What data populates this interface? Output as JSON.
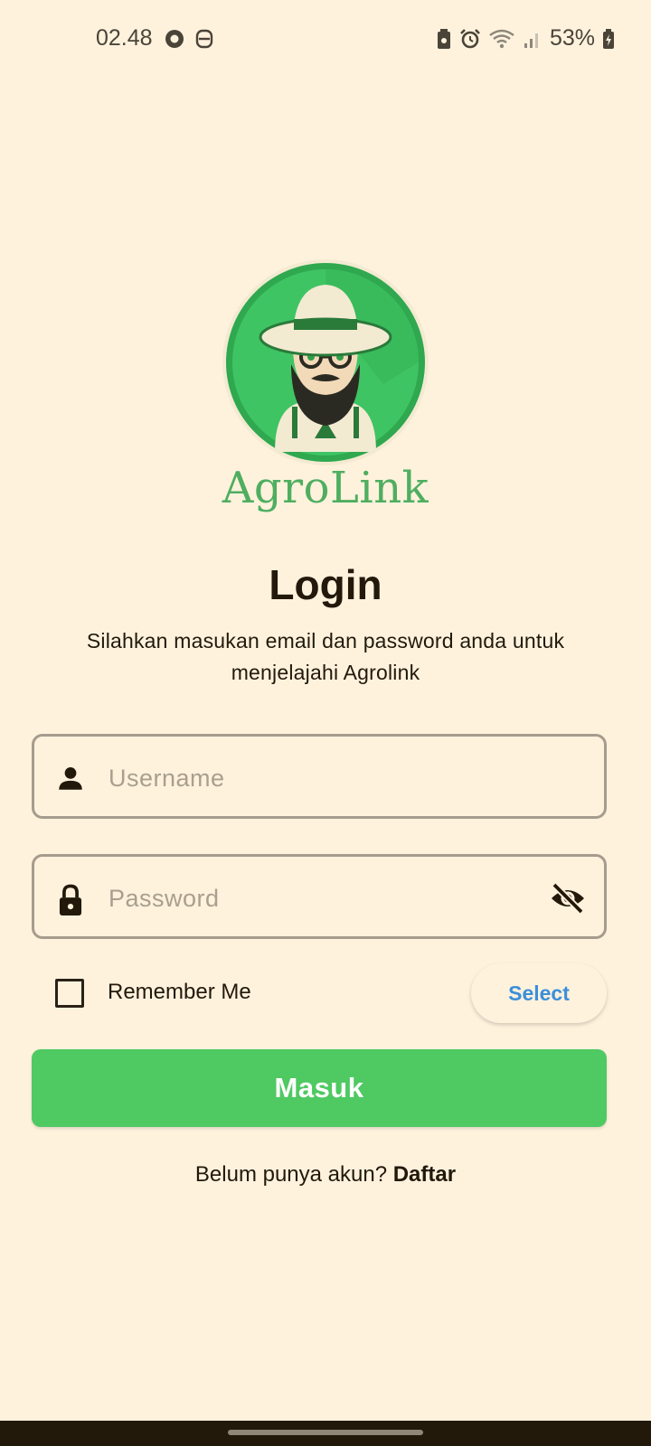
{
  "status_bar": {
    "time": "02.48",
    "battery_percent": "53%",
    "left_icons": [
      "circle-app-icon",
      "notification-app-icon"
    ],
    "right_icons": [
      "battery-saver-icon",
      "alarm-icon",
      "wifi-icon",
      "signal-icon",
      "battery-charging-icon"
    ]
  },
  "brand": {
    "name": "AgroLink",
    "logo_icon": "farmer-logo-icon"
  },
  "login": {
    "title": "Login",
    "subtitle": "Silahkan masukan email dan password anda untuk menjelajahi Agrolink",
    "username": {
      "placeholder": "Username",
      "value": "",
      "icon": "person-icon"
    },
    "password": {
      "placeholder": "Password",
      "value": "",
      "icon": "lock-icon",
      "toggle_icon": "visibility-off-icon"
    },
    "remember_me": {
      "label": "Remember Me",
      "checked": false
    },
    "select_label": "Select",
    "submit_label": "Masuk",
    "register_prompt": "Belum punya akun?",
    "register_link": "Daftar"
  },
  "colors": {
    "background": "#fef2dd",
    "primary_green": "#4fc962",
    "link_blue": "#3b8fd9",
    "text_dark": "#22190b"
  }
}
